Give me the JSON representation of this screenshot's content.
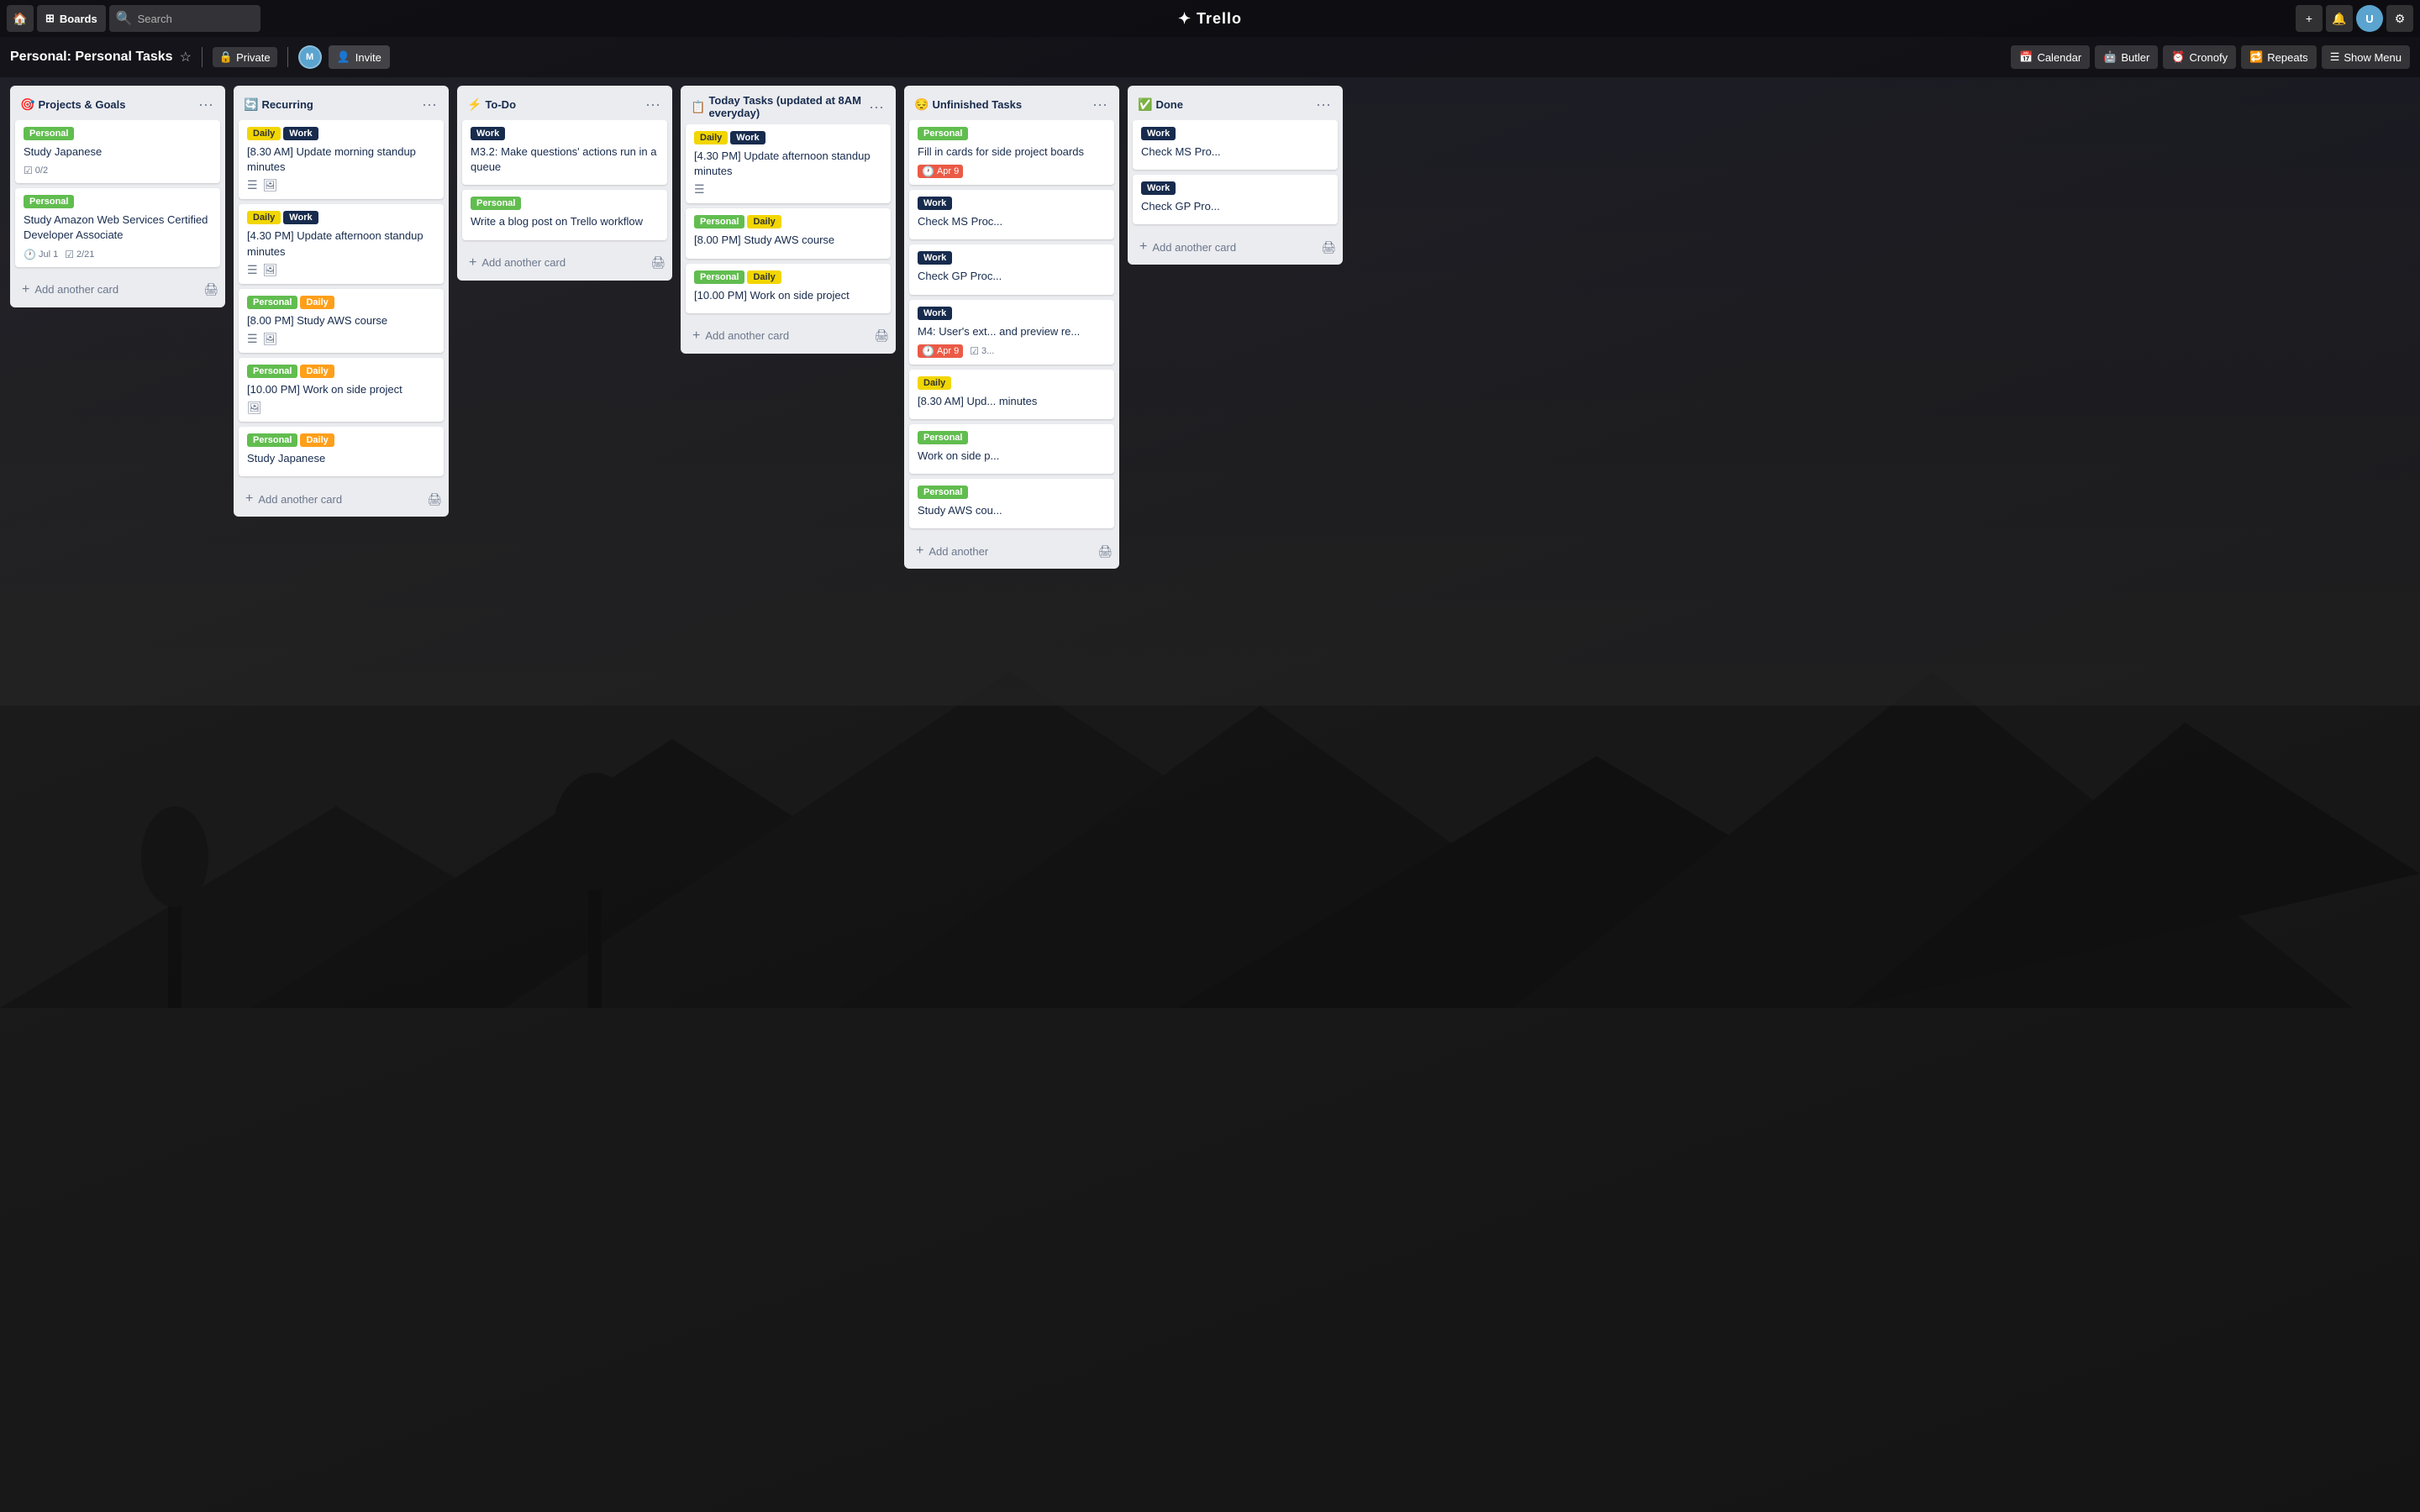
{
  "nav": {
    "home_icon": "🏠",
    "boards_label": "Boards",
    "search_placeholder": "Search",
    "logo": "✦ Trello",
    "add_icon": "+",
    "bell_icon": "🔔",
    "settings_icon": "⚙"
  },
  "board": {
    "title": "Personal: Personal Tasks",
    "visibility": "Private",
    "invite_label": "Invite",
    "tools": [
      {
        "icon": "📅",
        "label": "Calendar"
      },
      {
        "icon": "🤖",
        "label": "Butler"
      },
      {
        "icon": "⏰",
        "label": "Cronofy"
      },
      {
        "icon": "🔁",
        "label": "Repeats"
      },
      {
        "icon": "☰",
        "label": "Show Menu"
      }
    ]
  },
  "lists": [
    {
      "id": "projects-goals",
      "icon": "🎯",
      "title": "Projects & Goals",
      "cards": [
        {
          "labels": [
            {
              "color": "green",
              "text": "Personal"
            }
          ],
          "title": "Study Japanese",
          "badges": [
            {
              "type": "checklist",
              "icon": "☑",
              "text": "0/2"
            }
          ]
        },
        {
          "labels": [
            {
              "color": "green",
              "text": "Personal"
            }
          ],
          "title": "Study Amazon Web Services Certified Developer Associate",
          "badges": [
            {
              "type": "due",
              "icon": "🕐",
              "text": "Jul 1",
              "status": "normal"
            },
            {
              "type": "checklist",
              "icon": "☑",
              "text": "2/21"
            }
          ]
        }
      ],
      "add_card_label": "Add another card"
    },
    {
      "id": "recurring",
      "icon": "🔄",
      "title": "Recurring",
      "cards": [
        {
          "labels": [
            {
              "color": "yellow",
              "text": "Daily"
            },
            {
              "color": "dark",
              "text": "Work"
            }
          ],
          "title": "[8.30 AM] Update morning standup minutes",
          "actions": [
            "list",
            "card"
          ]
        },
        {
          "labels": [
            {
              "color": "yellow",
              "text": "Daily"
            },
            {
              "color": "dark",
              "text": "Work"
            }
          ],
          "title": "[4.30 PM] Update afternoon standup minutes",
          "actions": [
            "list",
            "card"
          ]
        },
        {
          "labels": [
            {
              "color": "green",
              "text": "Personal"
            },
            {
              "color": "orange",
              "text": "Daily"
            }
          ],
          "title": "[8.00 PM] Study AWS course",
          "actions": [
            "list",
            "card"
          ]
        },
        {
          "labels": [
            {
              "color": "green",
              "text": "Personal"
            },
            {
              "color": "orange",
              "text": "Daily"
            }
          ],
          "title": "[10.00 PM] Work on side project",
          "actions": [
            "card"
          ]
        },
        {
          "labels": [
            {
              "color": "green",
              "text": "Personal"
            },
            {
              "color": "orange",
              "text": "Daily"
            }
          ],
          "title": "Study Japanese",
          "actions": []
        }
      ],
      "add_card_label": "Add another card"
    },
    {
      "id": "to-do",
      "icon": "⚡",
      "title": "To-Do",
      "cards": [
        {
          "labels": [
            {
              "color": "dark",
              "text": "Work"
            }
          ],
          "title": "M3.2: Make questions' actions run in a queue",
          "badges": []
        },
        {
          "labels": [
            {
              "color": "green",
              "text": "Personal"
            }
          ],
          "title": "Write a blog post on Trello workflow",
          "badges": []
        }
      ],
      "add_card_label": "Add another card"
    },
    {
      "id": "today-tasks",
      "icon": "📋",
      "title": "Today Tasks (updated at 8AM everyday)",
      "cards": [
        {
          "labels": [
            {
              "color": "yellow",
              "text": "Daily"
            },
            {
              "color": "dark",
              "text": "Work"
            }
          ],
          "title": "[4.30 PM] Update afternoon standup minutes",
          "badges": [],
          "actions": [
            "list"
          ]
        },
        {
          "labels": [
            {
              "color": "green",
              "text": "Personal"
            },
            {
              "color": "yellow",
              "text": "Daily"
            }
          ],
          "title": "[8.00 PM] Study AWS course",
          "badges": []
        },
        {
          "labels": [
            {
              "color": "green",
              "text": "Personal"
            },
            {
              "color": "yellow",
              "text": "Daily"
            }
          ],
          "title": "[10.00 PM] Work on side project",
          "badges": []
        }
      ],
      "add_card_label": "Add another card"
    },
    {
      "id": "unfinished-tasks",
      "icon": "😔",
      "title": "Unfinished Tasks",
      "cards": [
        {
          "labels": [
            {
              "color": "green",
              "text": "Personal"
            }
          ],
          "title": "Fill in cards for side project boards",
          "badges": [
            {
              "type": "due",
              "icon": "🕐",
              "text": "Apr 9",
              "status": "overdue"
            }
          ]
        },
        {
          "labels": [
            {
              "color": "dark",
              "text": "Work"
            }
          ],
          "title": "Check MS Proc...",
          "badges": []
        },
        {
          "labels": [
            {
              "color": "dark",
              "text": "Work"
            }
          ],
          "title": "Check GP Proc...",
          "badges": []
        },
        {
          "labels": [
            {
              "color": "dark",
              "text": "Work"
            }
          ],
          "title": "M4: User's ext... and preview re...",
          "badges": [
            {
              "type": "due",
              "icon": "🕐",
              "text": "Apr 9",
              "status": "overdue"
            },
            {
              "type": "checklist",
              "icon": "☑",
              "text": "3..."
            }
          ]
        },
        {
          "labels": [
            {
              "color": "yellow",
              "text": "Daily"
            }
          ],
          "title": "[8.30 AM] Upd... minutes",
          "badges": []
        },
        {
          "labels": [
            {
              "color": "green",
              "text": "Personal"
            }
          ],
          "title": "Work on side p...",
          "badges": []
        },
        {
          "labels": [
            {
              "color": "green",
              "text": "Personal"
            }
          ],
          "title": "Study AWS cou...",
          "badges": []
        }
      ],
      "add_card_label": "Add another"
    },
    {
      "id": "done",
      "icon": "✅",
      "title": "Done",
      "cards": [
        {
          "labels": [
            {
              "color": "dark",
              "text": "Work"
            }
          ],
          "title": "Check MS Pro...",
          "badges": []
        },
        {
          "labels": [
            {
              "color": "dark",
              "text": "Work"
            }
          ],
          "title": "Check GP Pro...",
          "badges": []
        }
      ],
      "add_card_label": "Add another card"
    }
  ],
  "colors": {
    "green": "#61bd4f",
    "blue": "#0079bf",
    "orange": "#ff9f1a",
    "yellow": "#f2d600",
    "dark": "#172b4d",
    "purple": "#c377e0"
  }
}
